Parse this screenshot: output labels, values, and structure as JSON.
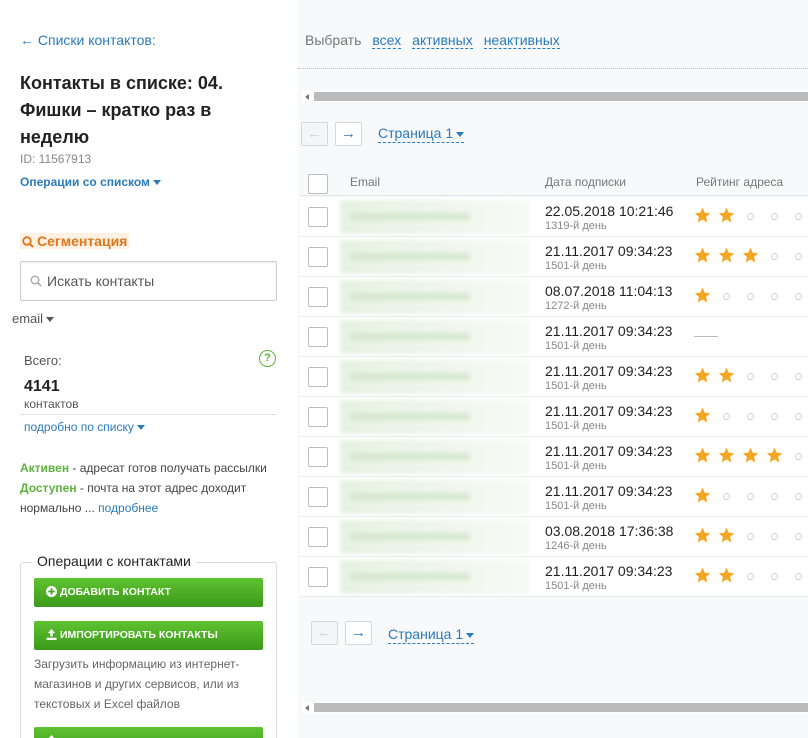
{
  "sidebar": {
    "back_link": "← Списки контактов:",
    "title": "Контакты в списке: 04. Фишки – кратко раз в неделю",
    "id_text": "ID: 11567913",
    "list_ops": "Операции со списком",
    "segmentation": "Сегментация",
    "search_placeholder": "Искать контакты",
    "email_filter": "email",
    "total_label": "Всего:",
    "total_count": "4141",
    "total_unit": "контактов",
    "details_link": "подробно по списку",
    "status_active": "Активен",
    "status_active_desc": " - адресат готов получать рассылки",
    "status_available": "Доступен",
    "status_available_desc": " - почта на этот адрес доходит нормально ... ",
    "more_link": "подробнее",
    "ops_legend": "Операции с контактами",
    "add_contact": "Добавить контакт",
    "import_contacts": "Импортировать контакты",
    "import_help": "Загрузить информацию из интернет-магазинов и других сервисов, или из текстовых и Excel файлов",
    "colors": {
      "link": "#2b7bb9",
      "green": "#5db33b",
      "orange": "#e0771b",
      "star": "#f5a623"
    }
  },
  "main": {
    "select_label": "Выбрать",
    "select_all": "всех",
    "select_active": "активных",
    "select_inactive": "неактивных",
    "page_label": "Страница 1",
    "columns": {
      "email": "Email",
      "date": "Дата подписки",
      "rating": "Рейтинг адреса"
    },
    "rows": [
      {
        "date": "22.05.2018 10:21:46",
        "days": "1319-й день",
        "rating": 2
      },
      {
        "date": "21.11.2017 09:34:23",
        "days": "1501-й день",
        "rating": 3
      },
      {
        "date": "08.07.2018 11:04:13",
        "days": "1272-й день",
        "rating": 1
      },
      {
        "date": "21.11.2017 09:34:23",
        "days": "1501-й день",
        "rating": null
      },
      {
        "date": "21.11.2017 09:34:23",
        "days": "1501-й день",
        "rating": 2
      },
      {
        "date": "21.11.2017 09:34:23",
        "days": "1501-й день",
        "rating": 1
      },
      {
        "date": "21.11.2017 09:34:23",
        "days": "1501-й день",
        "rating": 4
      },
      {
        "date": "21.11.2017 09:34:23",
        "days": "1501-й день",
        "rating": 1
      },
      {
        "date": "03.08.2018 17:36:38",
        "days": "1246-й день",
        "rating": 2
      },
      {
        "date": "21.11.2017 09:34:23",
        "days": "1501-й день",
        "rating": 2
      }
    ]
  }
}
